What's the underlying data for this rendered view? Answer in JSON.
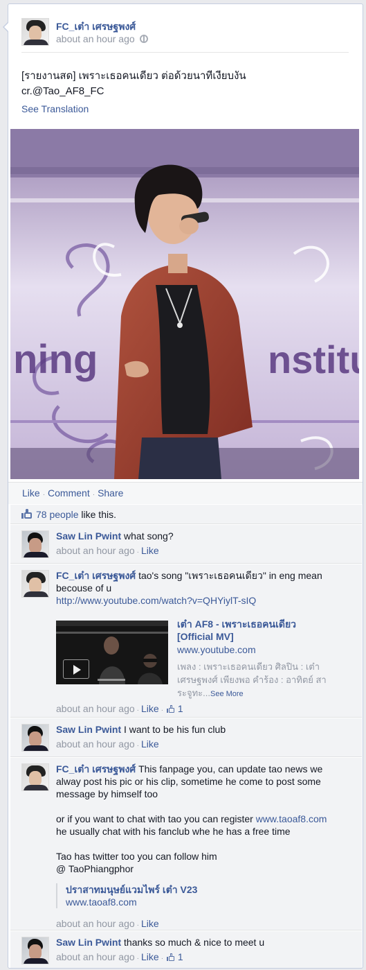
{
  "post": {
    "author": "FC_เต๋า เศรษฐพงศ์",
    "time": "about an hour ago",
    "privacy_icon": "globe-icon",
    "text_line1": "[รายงานสด] เพราะเธอคนเดียว ต่อด้วยนาทีเงียบงัน",
    "text_line2": "cr.@Tao_AF8_FC",
    "see_translation": "See Translation",
    "photo_sign_left": "ning",
    "photo_sign_right": "nstitutio"
  },
  "actions": {
    "like": "Like",
    "comment": "Comment",
    "share": "Share"
  },
  "likes": {
    "count": "78 people",
    "suffix": "like this."
  },
  "comments": [
    {
      "name": "Saw Lin Pwint",
      "text": "what song?",
      "time": "about an hour ago",
      "like": "Like"
    },
    {
      "name": "FC_เต๋า เศรษฐพงศ์",
      "text_line1": "tao's song \"เพราะเธอคนเดียว\" in eng mean",
      "text_line2": "becouse of u",
      "link": "http://www.youtube.com/watch?v=QHYiylT-sIQ",
      "share": {
        "title_line1": "เต๋า AF8 - เพราะเธอคนเดียว",
        "title_line2": "[Official MV]",
        "domain": "www.youtube.com",
        "desc_line1": "เพลง : เพราะเธอคนเดียว ศิลปิน : เต๋า",
        "desc_line2": "เศรษฐพงศ์ เพียงพอ คำร้อง : อาทิตย์ สา",
        "desc_line3": "ระจูทะ...",
        "see_more": "See More"
      },
      "time": "about an hour ago",
      "like": "Like",
      "like_count": "1"
    },
    {
      "name": "Saw Lin Pwint",
      "text": "I want to be his fun club",
      "time": "about an hour ago",
      "like": "Like"
    },
    {
      "name": "FC_เต๋า เศรษฐพงศ์",
      "text_line1": "This fanpage you, can update tao news we",
      "text_line2": "alway post his pic or his clip, sometime he come to post some",
      "text_line3": "message by himself too",
      "text_line4_pre": "or if you want to chat with tao you can register ",
      "text_line4_link": "www.taoaf8.com",
      "text_line5": "he usually chat with his fanclub whe he has a free time",
      "text_line6": "Tao has twitter too you can follow him",
      "text_line7": "@ TaoPhiangphor",
      "quote_title": "ปราสาทมนุษย์แวมไพร์ เต๋า V23",
      "quote_domain": "www.taoaf8.com",
      "time": "about an hour ago",
      "like": "Like"
    },
    {
      "name": "Saw Lin Pwint",
      "text": "thanks so much & nice to meet u",
      "time": "about an hour ago",
      "like": "Like",
      "like_count": "1"
    }
  ],
  "colors": {
    "link": "#3b5998",
    "meta": "#9197a3",
    "comment_bg": "#f2f3f5"
  }
}
